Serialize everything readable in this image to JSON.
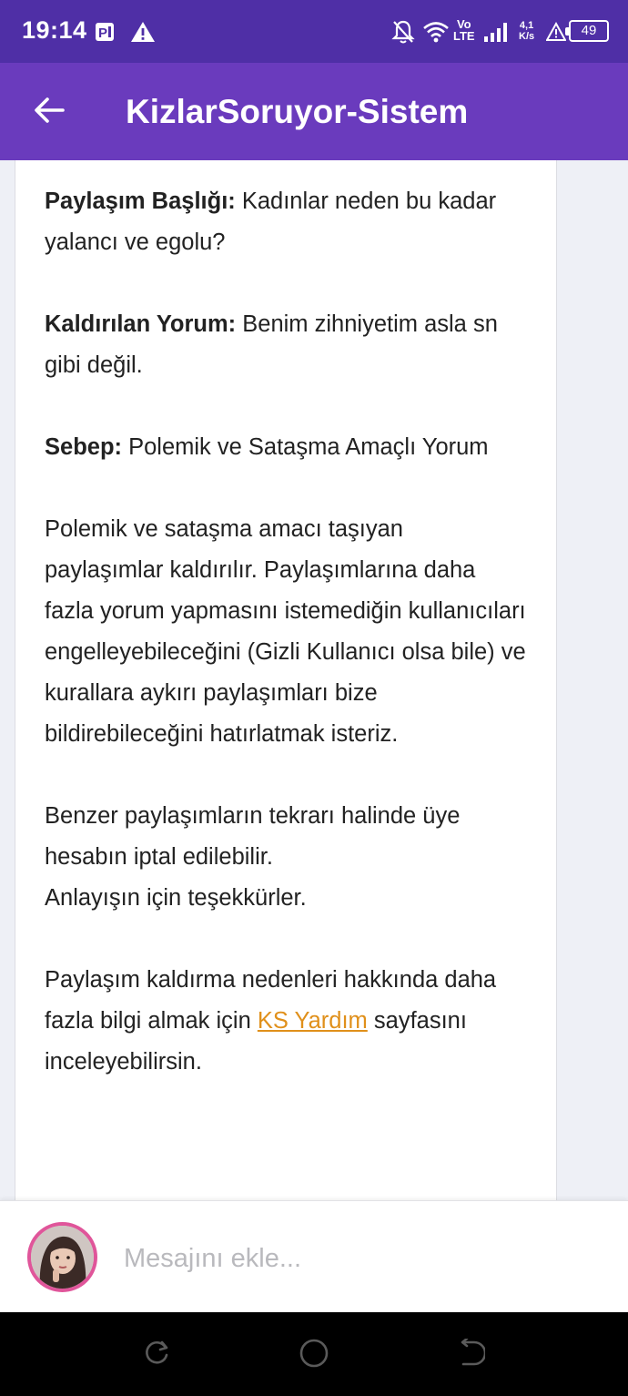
{
  "status_bar": {
    "time": "19:14",
    "left_icons": [
      "parking-notification-icon",
      "warning-icon"
    ],
    "right_icons": [
      "notifications-off-icon",
      "wifi-icon",
      "volte-icon",
      "signal-icon",
      "data-speed",
      "alert-icon",
      "battery-icon"
    ],
    "volte_top": "Vo",
    "volte_bottom": "LTE",
    "speed_value": "4,1",
    "speed_unit": "K/s",
    "battery_level": "49"
  },
  "app_bar": {
    "back_icon": "arrow-back-icon",
    "title": "KizlarSoruyor-Sistem"
  },
  "message": {
    "post_title_label": "Paylaşım Başlığı:",
    "post_title_value": " Kadınlar neden bu kadar yalancı ve egolu?",
    "removed_comment_label": "Kaldırılan Yorum:",
    "removed_comment_value": " Benim zihniyetim asla sn gibi değil.",
    "reason_label": "Sebep:",
    "reason_value": " Polemik ve Sataşma Amaçlı Yorum",
    "explanation": "Polemik ve sataşma amacı taşıyan paylaşımlar kaldırılır. Paylaşımlarına daha fazla yorum yapmasını istemediğin kullanıcıları engelleyebileceğini (Gizli Kullanıcı olsa bile) ve kurallara aykırı paylaşımları bize bildirebileceğini hatırlatmak isteriz.",
    "warning": "Benzer paylaşımların tekrarı halinde üye hesabın iptal edilebilir.",
    "thanks": "Anlayışın için teşekkürler.",
    "help_prefix": "Paylaşım kaldırma nedenleri hakkında daha fazla bilgi almak için ",
    "help_link": "KS Yardım",
    "help_suffix": " sayfasını inceleyebilirsin."
  },
  "input_bar": {
    "avatar_icon": "user-avatar",
    "placeholder": "Mesajını ekle...",
    "value": ""
  },
  "nav_bar": {
    "buttons": [
      "recent-apps-icon",
      "home-icon",
      "back-icon"
    ]
  },
  "colors": {
    "status_bar": "#4f2fa6",
    "app_bar": "#6a3bbd",
    "link": "#e0901b",
    "avatar_ring": "#e0559a"
  }
}
